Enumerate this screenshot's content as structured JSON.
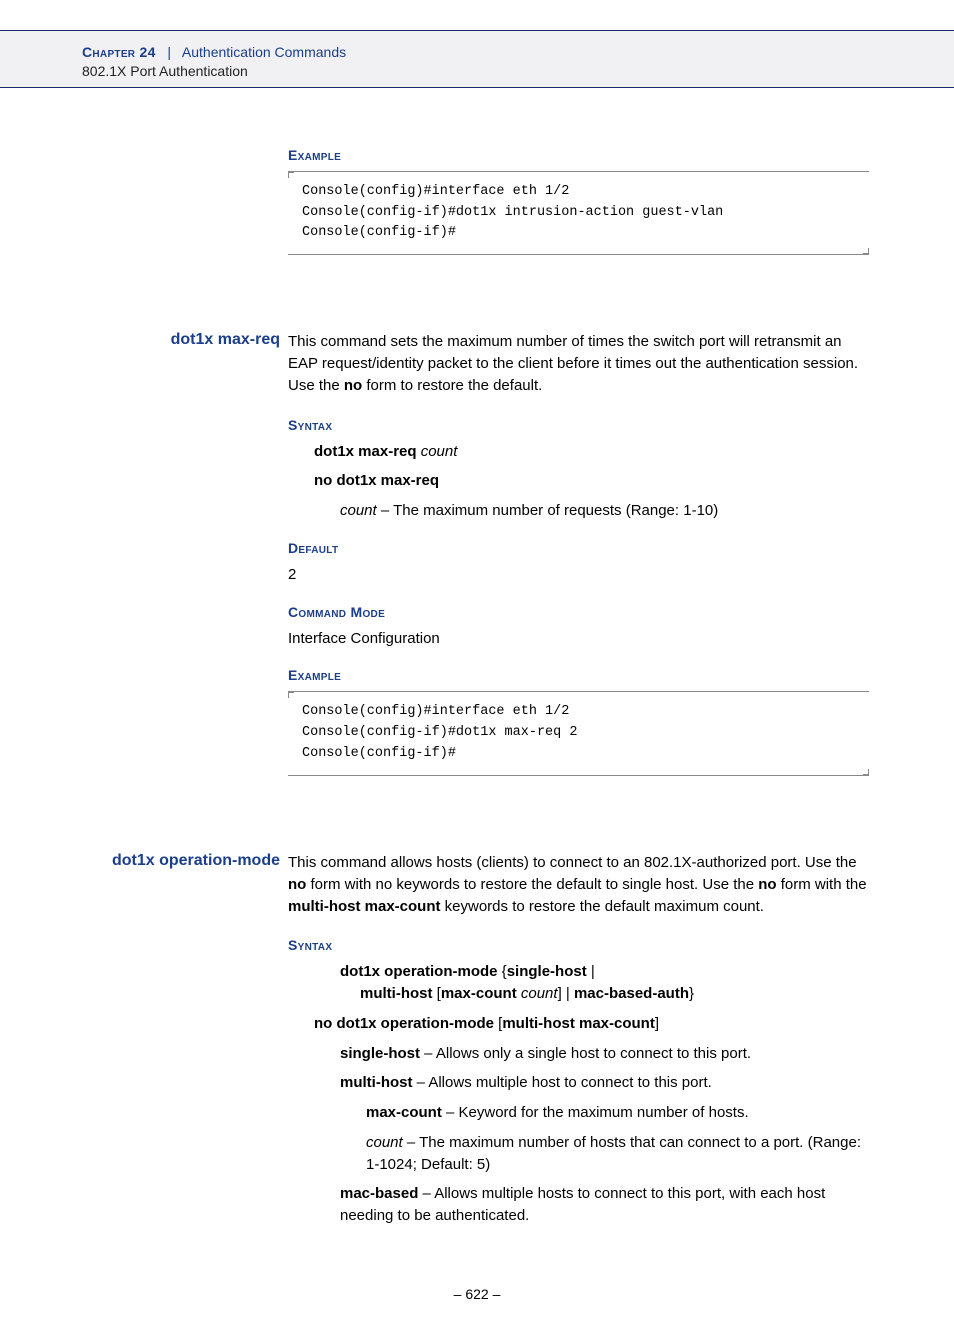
{
  "header": {
    "chapter_label": "Chapter 24",
    "separator": "|",
    "chapter_title": "Authentication Commands",
    "subheader": "802.1X Port Authentication"
  },
  "top_example": {
    "heading": "Example",
    "code": "Console(config)#interface eth 1/2\nConsole(config-if)#dot1x intrusion-action guest-vlan\nConsole(config-if)#"
  },
  "cmd1": {
    "name": "dot1x max-req",
    "desc_pre": "This command sets the maximum number of times the switch port will retransmit an EAP request/identity packet to the client before it times out the authentication session. Use the ",
    "desc_bold": "no",
    "desc_post": " form to restore the default.",
    "syntax_heading": "Syntax",
    "syntax_line1_b": "dot1x max-req ",
    "syntax_line1_i": "count",
    "syntax_line2_b": "no dot1x max-req",
    "param_i": "count",
    "param_t": " – The maximum number of requests (Range: 1-10)",
    "default_heading": "Default",
    "default_value": "2",
    "mode_heading": "Command Mode",
    "mode_value": "Interface Configuration",
    "example_heading": "Example",
    "code": "Console(config)#interface eth 1/2\nConsole(config-if)#dot1x max-req 2\nConsole(config-if)#"
  },
  "cmd2": {
    "name": "dot1x operation-mode",
    "d1": "This command allows hosts (clients) to connect to an 802.1X-authorized port. Use the ",
    "d_no1": "no",
    "d2": " form with no keywords to restore the default to single host. Use the ",
    "d_no2": "no",
    "d3": " form with the ",
    "d_mh": "multi-host max-count",
    "d4": " keywords to restore the default maximum count.",
    "syntax_heading": "Syntax",
    "s1a": "dot1x operation-mode",
    "s1b": " {",
    "s1c": "single-host",
    "s1d": " | ",
    "s1e": "multi-host",
    "s1f": " [",
    "s1g": "max-count",
    "s1h": " ",
    "s1i": "count",
    "s1j": "] | ",
    "s1k": "mac-based-auth",
    "s1l": "}",
    "s2a": "no dot1x operation-mode",
    "s2b": " [",
    "s2c": "multi-host max-count",
    "s2d": "]",
    "p_sh_b": "single-host",
    "p_sh_t": " – Allows only a single host to connect to this port.",
    "p_mh_b": "multi-host",
    "p_mh_t": " – Allows multiple host to connect to this port.",
    "p_mc_b": "max-count",
    "p_mc_t": " – Keyword for the maximum number of hosts.",
    "p_ct_i": "count",
    "p_ct_t": " – The maximum number of hosts that can connect to a port. (Range: 1-1024; Default: 5)",
    "p_mb_b": "mac-based",
    "p_mb_t": " – Allows multiple hosts to connect to this port, with each host needing to be authenticated."
  },
  "page_number": "–  622  –"
}
